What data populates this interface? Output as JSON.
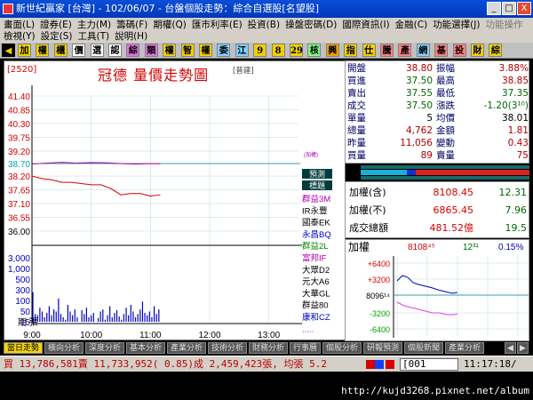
{
  "window": {
    "title": "新世紀贏家 [台灣] - 102/06/07 - 台盤個股走勢：綜合自選股[名望股]",
    "btn_min": "_",
    "btn_max": "□",
    "btn_close": "X"
  },
  "menu": {
    "row1": [
      "畫面(L)",
      "證券(E)",
      "主力(M)",
      "籌碼(F)",
      "期權(Q)",
      "匯市利率(E)",
      "投資(B)",
      "操盤密碼(D)",
      "國際資訊(I)",
      "金融(C)",
      "功能選擇(J)"
    ],
    "row1_dim": "功能操作",
    "row2": [
      "檢視(Y)",
      "設定(S)",
      "工具(T)",
      "說明(H)"
    ]
  },
  "toolbar": {
    "buttons": [
      "加",
      "權",
      "櫃",
      "價",
      "選",
      "認",
      "綜",
      "類",
      "權",
      "智",
      "權",
      "委",
      "江",
      "9",
      "8",
      "29",
      "核",
      "興",
      "指",
      "仕",
      "騰",
      "產",
      "網",
      "基",
      "投",
      "財",
      "綜"
    ]
  },
  "chart": {
    "code": "[2520]",
    "title": "冠德  量價走勢圖",
    "title_tag": "[普建]",
    "ref_label": "(加權)",
    "broker_box1": "預測",
    "broker_box2": "標題",
    "brokers": [
      "群益3M",
      "IR永豐",
      "國泰EK",
      "永昌BQ",
      "群益2L",
      "富邦IF",
      "大眾D2",
      "元大A6",
      "大華GL",
      "群益80",
      "康和CZ",
      "....."
    ],
    "broker_colors": [
      "#b000b0",
      "#000000",
      "#000000",
      "#0000cc",
      "#008800",
      "#b000b0",
      "#000000",
      "#000000",
      "#000000",
      "#000000",
      "#0000cc",
      "#b000b0"
    ],
    "period_label": "期  張"
  },
  "chart_data": {
    "type": "line",
    "price_yticks": [
      "41.40",
      "40.85",
      "40.30",
      "39.75",
      "39.20",
      "38.70",
      "38.20",
      "37.65",
      "37.10",
      "36.55",
      "36.00"
    ],
    "vol_yticks": [
      "3,000",
      "1,000",
      "500",
      "300",
      "100",
      "50",
      "15"
    ],
    "xticks": [
      "9:00",
      "10:00",
      "11:00",
      "12:00",
      "13:00"
    ],
    "reference_price": 38.7,
    "ylim": [
      36.0,
      41.4
    ],
    "price_series": {
      "name": "price",
      "x": [
        "9:00",
        "9:10",
        "9:20",
        "9:30",
        "9:40",
        "9:50",
        "10:00",
        "10:10",
        "10:20",
        "10:30",
        "10:40",
        "10:50",
        "11:00",
        "11:10"
      ],
      "values": [
        38.2,
        38.1,
        38.05,
        37.95,
        37.95,
        37.9,
        37.85,
        37.85,
        37.7,
        37.45,
        37.5,
        37.5,
        37.4,
        37.45
      ]
    },
    "index_series": {
      "name": "加權",
      "x": [
        "9:00",
        "9:15",
        "9:30",
        "9:45",
        "10:00",
        "10:15",
        "10:30",
        "10:45",
        "11:00",
        "11:10"
      ],
      "values": [
        38.68,
        38.72,
        38.75,
        38.72,
        38.74,
        38.73,
        38.7,
        38.68,
        38.7,
        38.69
      ]
    },
    "volume_values": [
      140,
      20,
      18,
      35,
      25,
      15,
      22,
      40,
      18,
      30,
      25,
      80,
      20,
      15,
      12,
      45,
      25,
      18,
      30,
      15,
      10,
      28,
      20,
      35,
      15,
      18,
      22,
      10,
      14,
      25,
      30,
      12,
      18,
      40,
      15,
      22,
      28,
      16,
      12,
      20,
      35,
      18,
      45,
      25,
      15,
      20,
      30,
      60,
      22,
      18,
      25,
      15,
      40,
      20,
      30
    ]
  },
  "stats": {
    "rows": [
      {
        "l1": "開盤",
        "v1": "38.80",
        "c1": "#b00000",
        "l2": "振幅",
        "v2": "3.88%",
        "c2": "#b00000"
      },
      {
        "l1": "買進",
        "v1": "37.50",
        "c1": "#006600",
        "l2": "最高",
        "v2": "38.85",
        "c2": "#b00000"
      },
      {
        "l1": "賣出",
        "v1": "37.55",
        "c1": "#006600",
        "l2": "最低",
        "v2": "37.35",
        "c2": "#006600"
      },
      {
        "l1": "成交",
        "v1": "37.50",
        "c1": "#006600",
        "l2": "漲跌",
        "v2": "-1.20(3¹⁰)",
        "c2": "#006600"
      },
      {
        "l1": "單量",
        "v1": "5",
        "c1": "#000000",
        "l2": "均價",
        "v2": "38.01",
        "c2": "#000000"
      },
      {
        "l1": "總量",
        "v1": "4,762",
        "c1": "#b00000",
        "l2": "金額",
        "v2": "1.81",
        "c2": "#b00000"
      },
      {
        "l1": "昨量",
        "v1": "11,056",
        "c1": "#b00000",
        "l2": "變動",
        "v2": "0.43",
        "c2": "#b00000"
      },
      {
        "l1": "買量",
        "v1": "89",
        "c1": "#b00000",
        "l2": "賣量",
        "v2": "75",
        "c2": "#b00000"
      }
    ]
  },
  "index": {
    "rows": [
      {
        "label": "加權(含)",
        "v1": "8108.45",
        "v2": "12.31"
      },
      {
        "label": "加權(不)",
        "v1": "6865.45",
        "v2": "7.96"
      },
      {
        "label": "成交總額",
        "v1": "481.52億",
        "v2": "19.5"
      }
    ]
  },
  "mini": {
    "label": "加權",
    "price": "8108⁴⁵",
    "chg": "12³¹",
    "pct": "0.15%",
    "yticks": [
      "+6400",
      "+3200",
      "8096¹⁴",
      "-3200",
      "-6400"
    ],
    "xticks": [
      "9",
      "10",
      "11",
      "12",
      "1"
    ]
  },
  "tabs": [
    "當日走勢",
    "橫向分析",
    "深度分析",
    "基本分析",
    "產業分析",
    "技術分析",
    "財務分析",
    "行事曆",
    "個股分析",
    "研報預測",
    "個股新聞",
    "產業分析"
  ],
  "status": {
    "text": "買 13,786,581賣 11,733,952( 0.85)成 2,459,423張, 均張 5.2",
    "input": "[001",
    "time": "11:17:18/"
  },
  "watermark": "http://kujd3268.pixnet.net/album",
  "colors": {
    "price_line": "#d40000",
    "index_line": "#b000b0",
    "ref_line": "#3aa0a0",
    "axis_price_up": "#d40000",
    "axis_ref": "#ffffff",
    "axis_price_down": "#00a000"
  }
}
